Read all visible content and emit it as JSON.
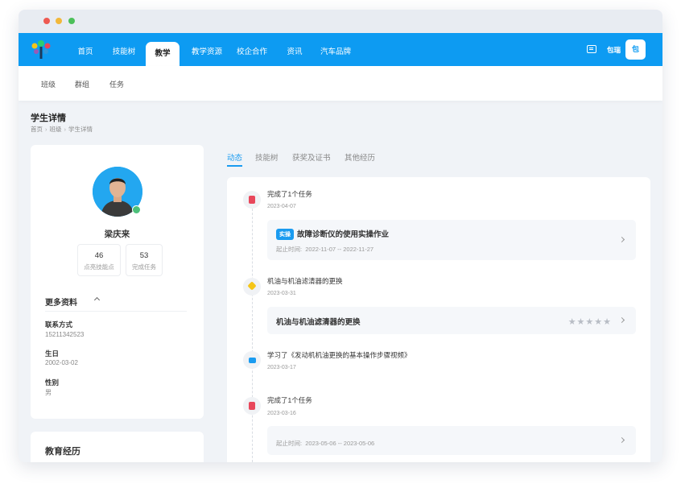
{
  "nav": {
    "items": [
      "首页",
      "技能树",
      "教学",
      "教学资源",
      "校企合作",
      "资讯",
      "汽车品牌"
    ],
    "active_index": 2,
    "user_name": "包瑞",
    "avatar_char": "包"
  },
  "subnav": {
    "items": [
      "班级",
      "群组",
      "任务"
    ]
  },
  "page": {
    "title": "学生详情",
    "breadcrumb": [
      "首页",
      "班级",
      "学生详情"
    ]
  },
  "profile": {
    "name": "梁庆来",
    "stats": [
      {
        "value": "46",
        "label": "点亮技能点"
      },
      {
        "value": "53",
        "label": "完成任务"
      }
    ],
    "more_title": "更多资料",
    "fields": [
      {
        "label": "联系方式",
        "value": "15211342523"
      },
      {
        "label": "生日",
        "value": "2002-03-02"
      },
      {
        "label": "性别",
        "value": "男"
      }
    ]
  },
  "education": {
    "title": "教育经历"
  },
  "tabs": [
    "动态",
    "技能树",
    "获奖及证书",
    "其他经历"
  ],
  "timeline": [
    {
      "icon": "clipboard-icon",
      "title": "完成了1个任务",
      "date": "2023-04-07",
      "box": {
        "tag": "实操",
        "title": "故障诊断仪的使用实操作业",
        "sub_label": "起止时间:",
        "sub_value": "2022-11-07 -- 2022-11-27"
      }
    },
    {
      "icon": "pin-icon",
      "title": "机油与机油滤清器的更换",
      "date": "2023-03-31",
      "box": {
        "title": "机油与机油滤清器的更换",
        "stars": 5
      }
    },
    {
      "icon": "video-icon",
      "title": "学习了《发动机机油更换的基本操作步骤视频》",
      "date": "2023-03-17"
    },
    {
      "icon": "clipboard-icon",
      "title": "完成了1个任务",
      "date": "2023-03-16",
      "box": {
        "sub_label": "起止时间:",
        "sub_value": "2023-05-06 -- 2023-05-06"
      }
    }
  ],
  "colors": {
    "primary": "#0d9bf2",
    "accent": "#1a9bf0",
    "task_icon": "#e8475b",
    "pin_icon": "#f5c518",
    "video_icon": "#1a9bf0"
  }
}
